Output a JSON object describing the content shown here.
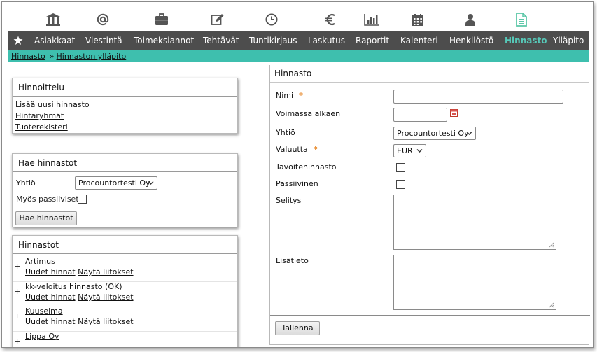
{
  "icon_bar": [
    {
      "name": "bank-icon"
    },
    {
      "name": "at-sign-icon"
    },
    {
      "name": "briefcase-icon"
    },
    {
      "name": "edit-icon"
    },
    {
      "name": "clock-icon"
    },
    {
      "name": "euro-icon"
    },
    {
      "name": "bar-chart-icon"
    },
    {
      "name": "calendar-icon"
    },
    {
      "name": "user-icon"
    },
    {
      "name": "document-icon"
    }
  ],
  "nav": {
    "items": [
      "Asiakkaat",
      "Viestintä",
      "Toimeksiannot",
      "Tehtävät",
      "Tuntikirjaus",
      "Laskutus",
      "Raportit",
      "Kalenteri",
      "Henkilöstö",
      "Hinnasto",
      "Ylläpito"
    ],
    "active": "Hinnasto"
  },
  "breadcrumb": {
    "items": [
      "Hinnasto",
      "Hinnaston ylläpito"
    ],
    "separator": "»"
  },
  "hinnoittelu": {
    "title": "Hinnoittelu",
    "links": [
      "Lisää uusi hinnasto",
      "Hintaryhmät",
      "Tuoterekisteri"
    ]
  },
  "search": {
    "title": "Hae hinnastot",
    "company_label": "Yhtiö",
    "company_value": "Procountortesti Oy",
    "passive_label": "Myös passiiviset",
    "button": "Hae hinnastot"
  },
  "pricelists": {
    "title": "Hinnastot",
    "plus": "+",
    "new_prices": "Uudet hinnat",
    "show_links": "Näytä liitokset",
    "items": [
      "Artimus",
      "kk-veloitus hinnasto (OK)",
      "Kuuselma",
      "Lippa Oy"
    ]
  },
  "form": {
    "title": "Hinnasto",
    "required_mark": "*",
    "name_label": "Nimi",
    "valid_from_label": "Voimassa alkaen",
    "company_label": "Yhtiö",
    "company_value": "Procountortesti Oy",
    "currency_label": "Valuutta",
    "currency_value": "EUR",
    "target_label": "Tavoitehinnasto",
    "passive_label": "Passiivinen",
    "description_label": "Selitys",
    "additional_label": "Lisätieto",
    "save_button": "Tallenna"
  },
  "colors": {
    "nav_bg": "#4d4d4d",
    "accent": "#3ebfae",
    "active_nav": "#56c8b8",
    "required": "#e8892a",
    "icon": "#555555",
    "document_icon": "#5cc7a8"
  }
}
